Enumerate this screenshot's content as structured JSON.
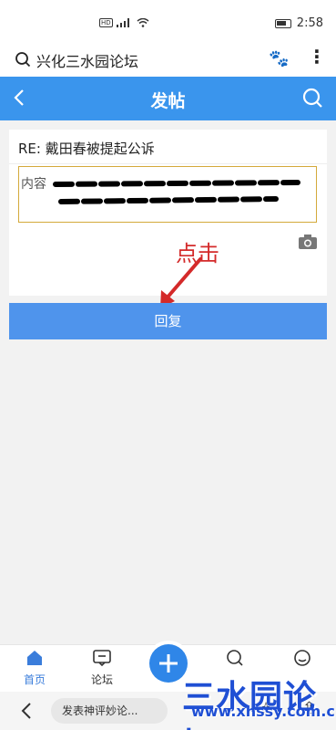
{
  "status_bar": {
    "sim_label": "HD",
    "time": "2:58"
  },
  "browser": {
    "title": "兴化三水园论坛"
  },
  "nav": {
    "title": "发帖"
  },
  "form": {
    "title_value": "RE: 戴田春被提起公诉",
    "content_placeholder": "内容"
  },
  "annotation": {
    "text": "点击"
  },
  "reply_button": {
    "label": "回复"
  },
  "tabs": [
    {
      "label": "首页",
      "active": true
    },
    {
      "label": "论坛",
      "active": false
    },
    {
      "label": "",
      "active": false
    },
    {
      "label": "",
      "active": false
    }
  ],
  "bottom_bar": {
    "comment_placeholder": "发表神评妙论..."
  },
  "watermark": {
    "text": "三水园论坛",
    "url": "www.xhssy.com.cn"
  },
  "colors": {
    "accent": "#3a95ed",
    "button": "#4f94ec",
    "annotation": "#d42a2a",
    "watermark": "#1f4fd4"
  }
}
